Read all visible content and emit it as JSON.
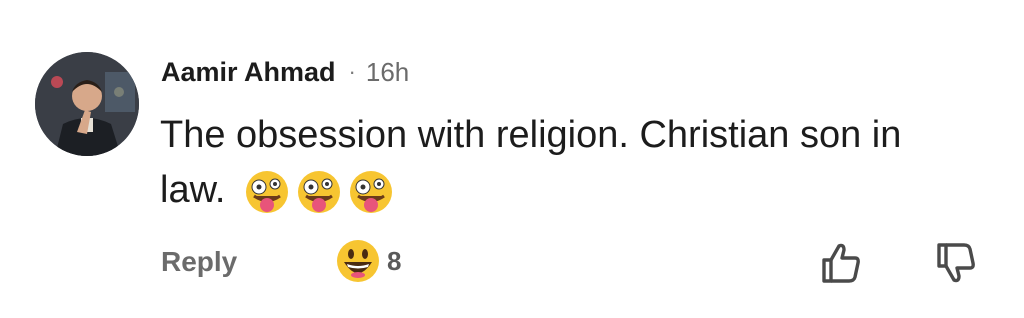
{
  "comment": {
    "author": "Aamir Ahmad",
    "separator": "·",
    "time": "16h",
    "text": "The obsession with religion. Christian son in law.",
    "inline_emojis": [
      "zany-face",
      "zany-face",
      "zany-face"
    ]
  },
  "actions": {
    "reply_label": "Reply",
    "reaction_icon": "grinning-face-with-big-eyes",
    "reaction_count": "8",
    "like_icon": "thumbs-up-icon",
    "dislike_icon": "thumbs-down-icon"
  },
  "colors": {
    "text": "#1c1c1c",
    "muted": "#6b6b6b",
    "emoji_yellow": "#f7c531",
    "tongue": "#e8547a"
  }
}
